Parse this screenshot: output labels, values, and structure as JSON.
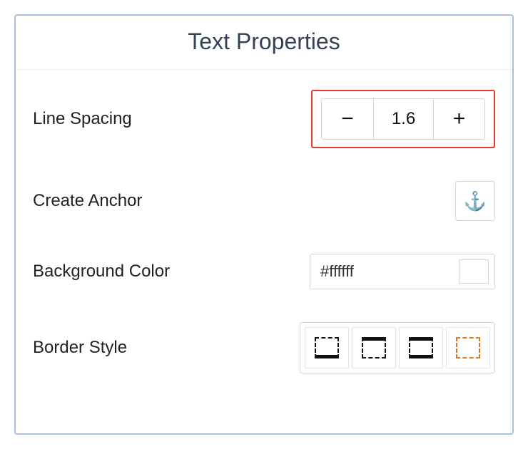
{
  "header": {
    "title": "Text Properties"
  },
  "lineSpacing": {
    "label": "Line Spacing",
    "value": "1.6",
    "decrement": "−",
    "increment": "+",
    "highlighted": true
  },
  "createAnchor": {
    "label": "Create Anchor",
    "iconGlyph": "⚓"
  },
  "backgroundColor": {
    "label": "Background Color",
    "value": "#ffffff",
    "swatchColor": "#ffffff"
  },
  "borderStyle": {
    "label": "Border Style",
    "options": [
      {
        "id": "bottom-solid"
      },
      {
        "id": "top-solid"
      },
      {
        "id": "top-bottom-solid"
      },
      {
        "id": "dashed-orange"
      }
    ]
  }
}
